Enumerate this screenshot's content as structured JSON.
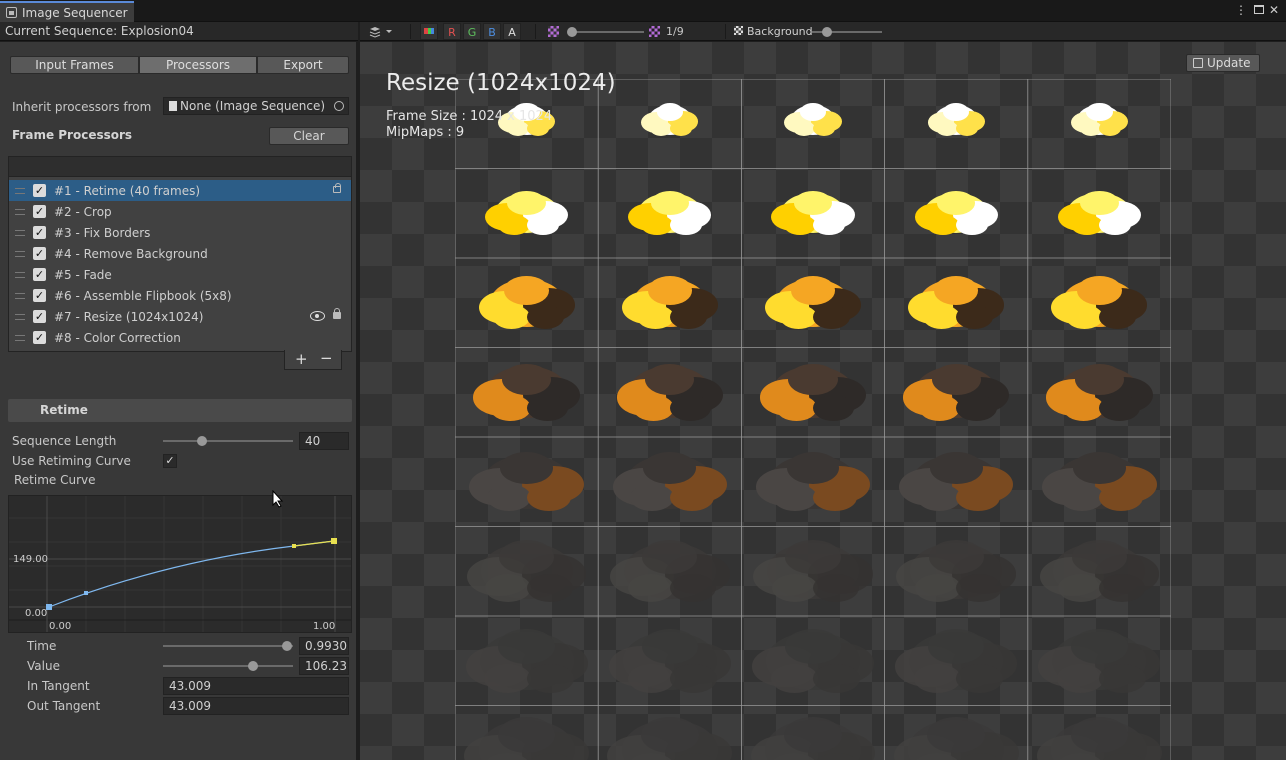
{
  "window": {
    "tab_title": "Image Sequencer",
    "menu_icon": "kebab-icon",
    "maximize_icon": "maximize-icon",
    "close_icon": "close-icon"
  },
  "sequence_bar": {
    "label": "Current Sequence: Explosion04"
  },
  "view_toolbar": {
    "channels": [
      "R",
      "G",
      "B",
      "A"
    ],
    "mip_label": "1/9",
    "background_label": "Background",
    "mip_level": 0.0,
    "background_level": 0.5
  },
  "tabs": {
    "input_frames": "Input Frames",
    "processors": "Processors",
    "export": "Export"
  },
  "inherit": {
    "label": "Inherit processors from",
    "value": "None (Image Sequence)"
  },
  "frame_processors": {
    "title": "Frame Processors",
    "clear_label": "Clear",
    "items": [
      {
        "label": "#1 - Retime (40 frames)",
        "selected": true
      },
      {
        "label": "#2 - Crop"
      },
      {
        "label": "#3 - Fix Borders"
      },
      {
        "label": "#4 - Remove Background"
      },
      {
        "label": "#5 - Fade"
      },
      {
        "label": "#6 - Assemble Flipbook (5x8)"
      },
      {
        "label": "#7 - Resize (1024x1024)"
      },
      {
        "label": "#8 - Color Correction"
      }
    ],
    "add_label": "+",
    "remove_label": "−"
  },
  "retime": {
    "header": "Retime",
    "sequence_length_label": "Sequence Length",
    "sequence_length_value": "40",
    "sequence_length_fraction": 0.28,
    "use_curve_label": "Use Retiming Curve",
    "use_curve_checked": true,
    "curve_label": "Retime Curve",
    "curve": {
      "y_max_label": "149.00",
      "y_min_label": "0.00",
      "x_min_label": "0.00",
      "x_max_label": "1.00"
    },
    "time_label": "Time",
    "time_value": "0.99305",
    "time_fraction": 0.99,
    "value_label": "Value",
    "value_value": "106.231",
    "value_fraction": 0.71,
    "in_tangent_label": "In Tangent",
    "in_tangent_value": "43.009",
    "out_tangent_label": "Out Tangent",
    "out_tangent_value": "43.009"
  },
  "viewer": {
    "title": "Resize (1024x1024)",
    "frame_size": "Frame Size : 1024 x 1024",
    "mipmaps": "MipMaps : 9",
    "update_label": "Update"
  }
}
